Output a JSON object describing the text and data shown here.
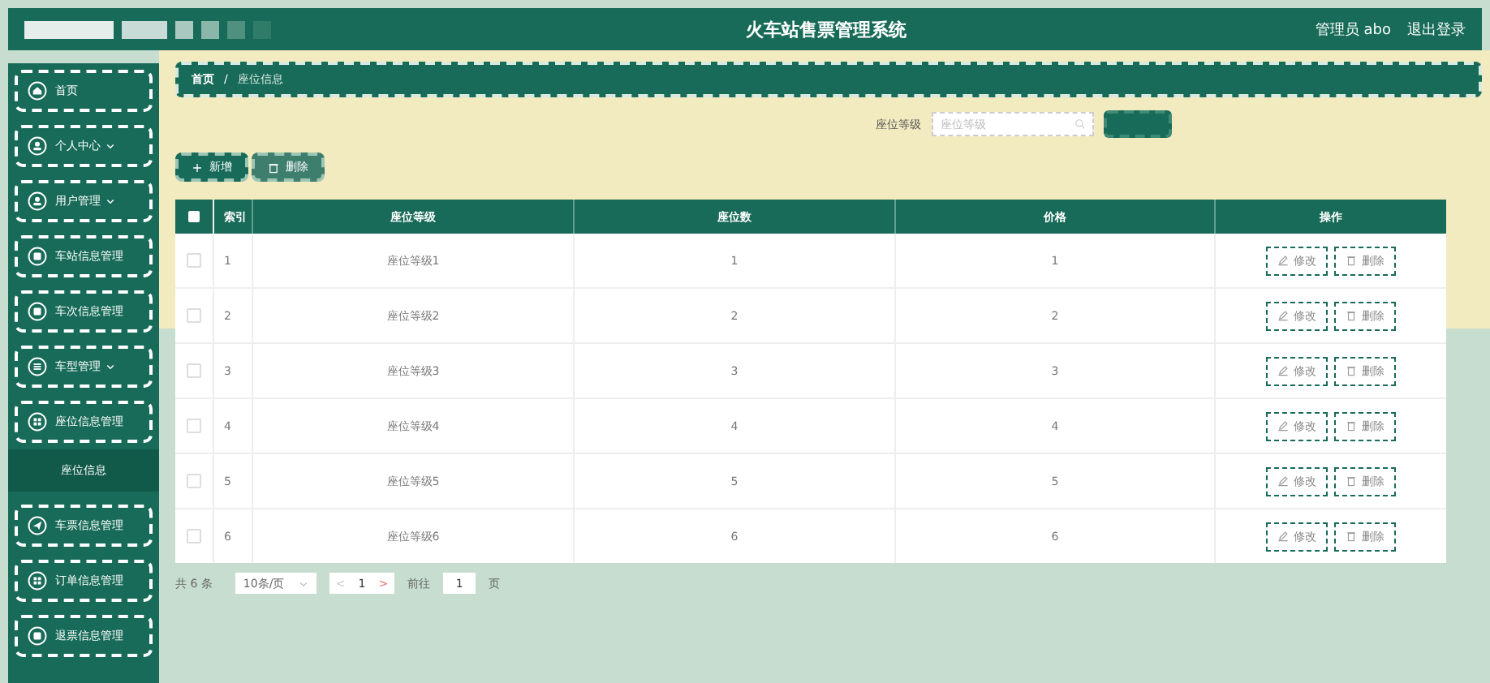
{
  "header": {
    "title": "火车站售票管理系统",
    "user": "管理员 abo",
    "logout": "退出登录"
  },
  "sidebar": {
    "items": [
      {
        "label": "首页",
        "has_submenu": false
      },
      {
        "label": "个人中心",
        "has_submenu": true
      },
      {
        "label": "用户管理",
        "has_submenu": true
      },
      {
        "label": "车站信息管理",
        "has_submenu": false
      },
      {
        "label": "车次信息管理",
        "has_submenu": false
      },
      {
        "label": "车型管理",
        "has_submenu": true
      },
      {
        "label": "座位信息管理",
        "has_submenu": false,
        "children": [
          {
            "label": "座位信息",
            "selected": true
          }
        ]
      },
      {
        "label": "车票信息管理",
        "has_submenu": false
      },
      {
        "label": "订单信息管理",
        "has_submenu": false
      },
      {
        "label": "退票信息管理",
        "has_submenu": false
      }
    ]
  },
  "breadcrumb": {
    "items": [
      "首页",
      "座位信息"
    ],
    "separator": "/"
  },
  "search": {
    "label": "座位等级",
    "placeholder": "座位等级"
  },
  "actions": [
    {
      "label": "新增",
      "kind": "add"
    },
    {
      "label": "删除",
      "kind": "delete"
    }
  ],
  "table": {
    "all_checked": false,
    "columns": [
      "索引",
      "座位等级",
      "座位数",
      "价格",
      "操作"
    ],
    "rows": [
      {
        "checked": false,
        "cells": [
          "1",
          "座位等级1",
          "1",
          "1"
        ],
        "actions": [
          "修改",
          "删除"
        ]
      },
      {
        "checked": false,
        "cells": [
          "2",
          "座位等级2",
          "2",
          "2"
        ],
        "actions": [
          "修改",
          "删除"
        ]
      },
      {
        "checked": false,
        "cells": [
          "3",
          "座位等级3",
          "3",
          "3"
        ],
        "actions": [
          "修改",
          "删除"
        ]
      },
      {
        "checked": false,
        "cells": [
          "4",
          "座位等级4",
          "4",
          "4"
        ],
        "actions": [
          "修改",
          "删除"
        ]
      },
      {
        "checked": false,
        "cells": [
          "5",
          "座位等级5",
          "5",
          "5"
        ],
        "actions": [
          "修改",
          "删除"
        ]
      },
      {
        "checked": false,
        "cells": [
          "6",
          "座位等级6",
          "6",
          "6"
        ],
        "actions": [
          "修改",
          "删除"
        ]
      }
    ]
  },
  "pagination": {
    "total": "共 6 条",
    "page_size": "10条/页",
    "prev": "<",
    "page": "1",
    "next": ">",
    "goto_label": "前往",
    "goto_value": "1",
    "goto_unit": "页"
  }
}
